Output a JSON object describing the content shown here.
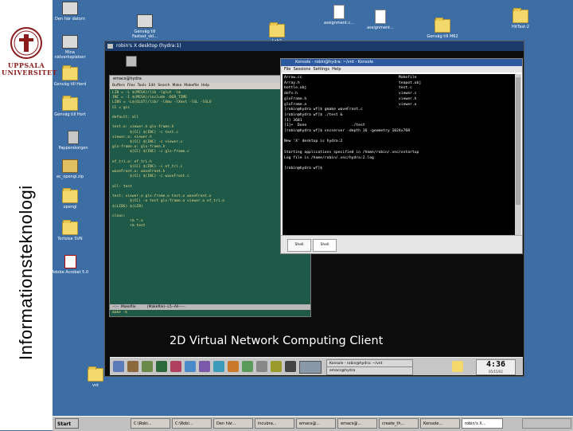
{
  "sidebar": {
    "university_name_line1": "UPPSALA",
    "university_name_line2": "UNIVERSITET",
    "vertical_title": "Informationsteknologi"
  },
  "desktop_icons": [
    {
      "label": "Den här datorn",
      "icon": "computer-icon"
    },
    {
      "label": "Mina nätverksplatser",
      "icon": "network-places-icon"
    },
    {
      "label": "Genväg till Herd",
      "icon": "shortcut-folder-icon"
    },
    {
      "label": "Genväg till Hort",
      "icon": "shortcut-folder-icon"
    },
    {
      "label": "Papperskorgen",
      "icon": "recycle-bin-icon"
    },
    {
      "label": "ac_opengl.zip",
      "icon": "zip-icon"
    },
    {
      "label": "opengl",
      "icon": "folder-icon"
    },
    {
      "label": "Tortoise SVN",
      "icon": "folder-icon"
    },
    {
      "label": "Adobe Acrobat 5.0",
      "icon": "acrobat-icon"
    },
    {
      "label": "vnt",
      "icon": "folder-icon"
    },
    {
      "label": "Genväg till Fastest_skl...",
      "icon": "window-shortcut-icon"
    },
    {
      "label": "Lab2",
      "icon": "folder-icon"
    },
    {
      "label": "assignment.c...",
      "icon": "c-file-icon"
    },
    {
      "label": "assignment...",
      "icon": "c-file-icon"
    },
    {
      "label": "Genväg till M62",
      "icon": "folder-icon"
    },
    {
      "label": "HitTest-2",
      "icon": "folder-icon"
    }
  ],
  "vnc": {
    "window_title": "robin's X desktop (hydra:1)",
    "caption": "2D Virtual Network Computing Client"
  },
  "emacs": {
    "title": "emacs@hydra",
    "menu": [
      "Buffers",
      "Files",
      "Tools",
      "Edit",
      "Search",
      "Make",
      "Makefile",
      "Help"
    ],
    "lines": [
      "LIB = -L $(MESA)/lib -lglut -lm",
      "INC = -I $(MESA)/include -DGR_TIME",
      "LIBS = -L$(GLUT)/lib/ -lXmu -lXext -lGL -lGLU",
      "CC = gcc",
      "",
      "default: all",
      "",
      "test.o: viewer.h glx-frame.h",
      "        $(CC) $(INC) -c test.c",
      "viewer.o: viewer.h",
      "        $(CC) $(INC) -c viewer.c",
      "glx-frame.o: glx-frame.h",
      "        $(CC) $(INC) -c glx-frame.c",
      "",
      "ef_tri.o: ef_tri.h",
      "        $(CC) $(INC) -c ef_tri.c",
      "waveFront.o: waveFront.h",
      "        $(CC) $(INC) -c waveFront.c",
      "",
      "all: test",
      "",
      "test: viewer.o glx-frame.o test.o waveFront.o",
      "        $(CC) -o test glx-frame.o viewer.o ef_tri.o",
      "$(LIBS) $(LIB)",
      "",
      "clean:",
      "        rm *.o",
      "        rm test"
    ],
    "modeline": "--:--  Makefile          (Makefile)--L5--All-----",
    "minibuffer": "make -k"
  },
  "konsole": {
    "title": "Konsole - robin@hydra: ~/vnt - Konsole",
    "menu": [
      "File",
      "Sessions",
      "Settings",
      "Help"
    ],
    "lines": [
      "Arrow.cc                                           Makefile",
      "Array.h                                            teapot.obj",
      "bottle.obj                                         test.c",
      "dofs.h                                             viewer.c",
      "glxFrame.h                                         viewer.h",
      "glxFrame.o                                         viewer.o",
      "[robin@hydra wf]$ gmake waveFront.c",
      "[robin@hydra wf]$ ./test &",
      "[1] 3681",
      "[1]+  Done                    ./test",
      "[robin@hydra wf]$ vncserver -depth 16 -geometry 1024x768",
      "",
      "New 'X' desktop is hydra:2",
      "",
      "Starting applications specified in /home/robin/.vnc/xstartup",
      "Log file is /home/robin/.vnc/hydra:2.log",
      "",
      "[robin@hydra wf]$ "
    ],
    "tabs": [
      "Shell",
      "Shell"
    ]
  },
  "vnc_panel": {
    "tasks": [
      "Konsole - robin@hydra: ~/vnt",
      "emacs@hydra"
    ],
    "clock": "4:36",
    "date": "05/15/02"
  },
  "taskbar": {
    "start_label": "Start",
    "tasks": [
      "C:\\Robi...",
      "C:\\Robi...",
      "Den här...",
      "incubra...",
      "emacs@...",
      "emacs@...",
      "create_th...",
      "Konsole...",
      "robin's X..."
    ]
  }
}
